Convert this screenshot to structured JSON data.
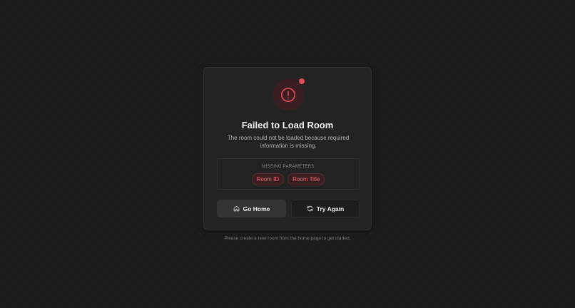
{
  "error": {
    "title": "Failed to Load Room",
    "description": "The room could not be loaded because required information is missing.",
    "icon": "alert-circle-icon"
  },
  "missing_parameters": {
    "label": "MISSING PARAMETERS",
    "items": [
      "Room ID",
      "Room Title"
    ]
  },
  "actions": {
    "home_label": "Go Home",
    "home_icon": "home-icon",
    "retry_label": "Try Again",
    "retry_icon": "refresh-icon"
  },
  "footer": {
    "hint": "Please create a new room from the home page to get started."
  },
  "colors": {
    "accent": "#e24b55",
    "background": "#1c1c1c",
    "card": "#232323"
  }
}
